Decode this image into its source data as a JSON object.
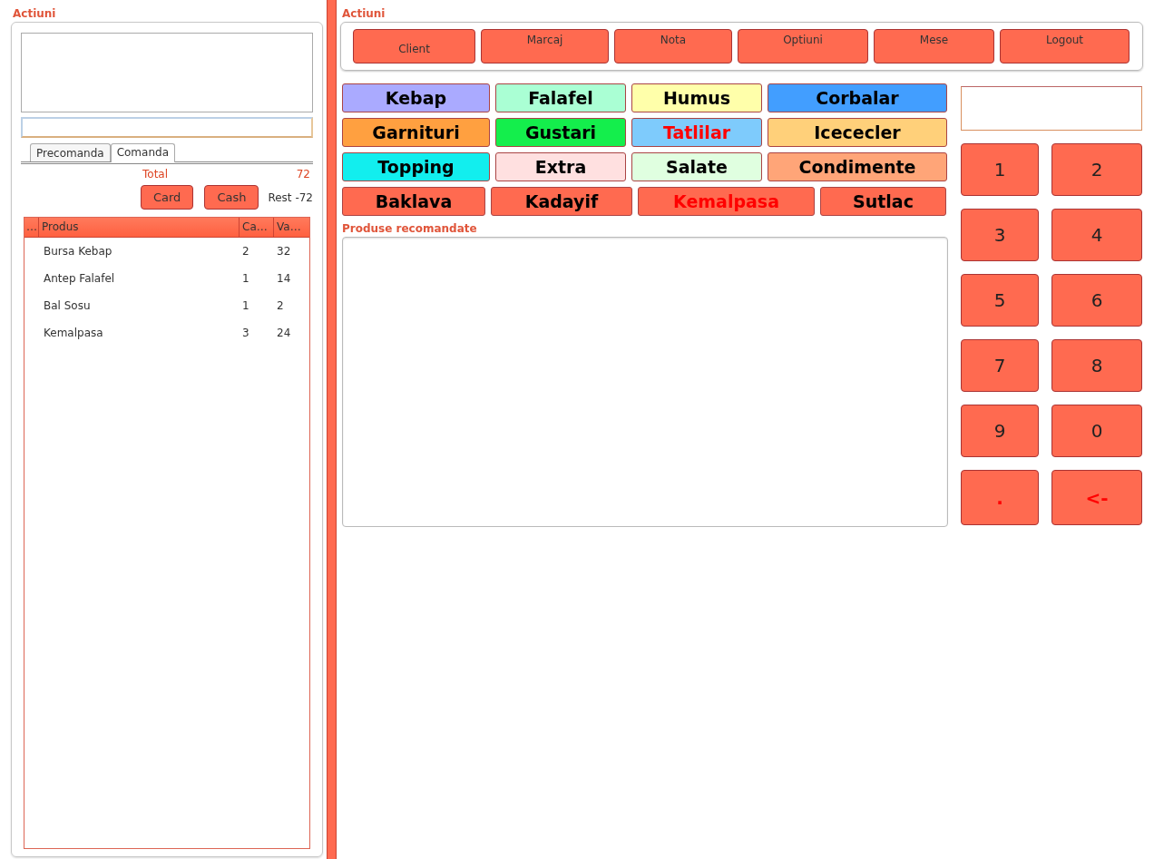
{
  "order_panel": {
    "title": "Actiuni",
    "tabs": [
      {
        "label": "Precomanda",
        "selected": false
      },
      {
        "label": "Comanda",
        "selected": true
      }
    ],
    "total": {
      "label": "Total",
      "value": "72"
    },
    "payment_buttons": [
      "Card",
      "Cash"
    ],
    "rest": "Rest -72",
    "table": {
      "columns": [
        "…",
        "Produs",
        "Ca…",
        "Va…"
      ],
      "rows": [
        [
          "",
          "Bursa Kebap",
          "2",
          "32"
        ],
        [
          "",
          "Antep Falafel",
          "1",
          "14"
        ],
        [
          "",
          "Bal Sosu",
          "1",
          "2"
        ],
        [
          "",
          "Kemalpasa",
          "3",
          "24"
        ]
      ]
    }
  },
  "actions": {
    "title": "Actiuni",
    "buttons": [
      "Client",
      "Marcaj",
      "Nota",
      "Optiuni",
      "Mese",
      "Logout"
    ]
  },
  "categories": [
    [
      {
        "label": "Kebap",
        "color": "#aaaaff",
        "highlighted": false
      },
      {
        "label": "Falafel",
        "color": "#aaffd4",
        "highlighted": false
      },
      {
        "label": "Humus",
        "color": "#ffffaa",
        "highlighted": false
      },
      {
        "label": "Corbalar",
        "color": "#429eff",
        "highlighted": false
      }
    ],
    [
      {
        "label": "Garnituri",
        "color": "#ffa040",
        "highlighted": false
      },
      {
        "label": "Gustari",
        "color": "#14ee4c",
        "highlighted": false
      },
      {
        "label": "Tatlilar",
        "color": "#7ecbfc",
        "highlighted": true
      },
      {
        "label": "Icececler",
        "color": "#ffd07a",
        "highlighted": false
      }
    ],
    [
      {
        "label": "Topping",
        "color": "#12eeee",
        "highlighted": false
      },
      {
        "label": "Extra",
        "color": "#ffe0e0",
        "highlighted": false
      },
      {
        "label": "Salate",
        "color": "#e0ffe0",
        "highlighted": false
      },
      {
        "label": "Condimente",
        "color": "#ffa578",
        "highlighted": false
      }
    ],
    [
      {
        "label": "Baklava",
        "color": "#ff6a50",
        "highlighted": false
      },
      {
        "label": "Kadayif",
        "color": "#ff6a50",
        "highlighted": false
      },
      {
        "label": "Kemalpasa",
        "color": "#ff6a50",
        "highlighted": true
      },
      {
        "label": "Sutlac",
        "color": "#ff6a50",
        "highlighted": false
      }
    ]
  ],
  "recommended": {
    "title": "Produse recomandate"
  },
  "keypad": {
    "keys": [
      {
        "label": "1",
        "kind": "digit"
      },
      {
        "label": "2",
        "kind": "digit"
      },
      {
        "label": "3",
        "kind": "digit"
      },
      {
        "label": "4",
        "kind": "digit"
      },
      {
        "label": "5",
        "kind": "digit"
      },
      {
        "label": "6",
        "kind": "digit"
      },
      {
        "label": "7",
        "kind": "digit"
      },
      {
        "label": "8",
        "kind": "digit"
      },
      {
        "label": "9",
        "kind": "digit"
      },
      {
        "label": "0",
        "kind": "digit"
      },
      {
        "label": ".",
        "kind": "symbol"
      },
      {
        "label": "<-",
        "kind": "symbol"
      }
    ]
  }
}
